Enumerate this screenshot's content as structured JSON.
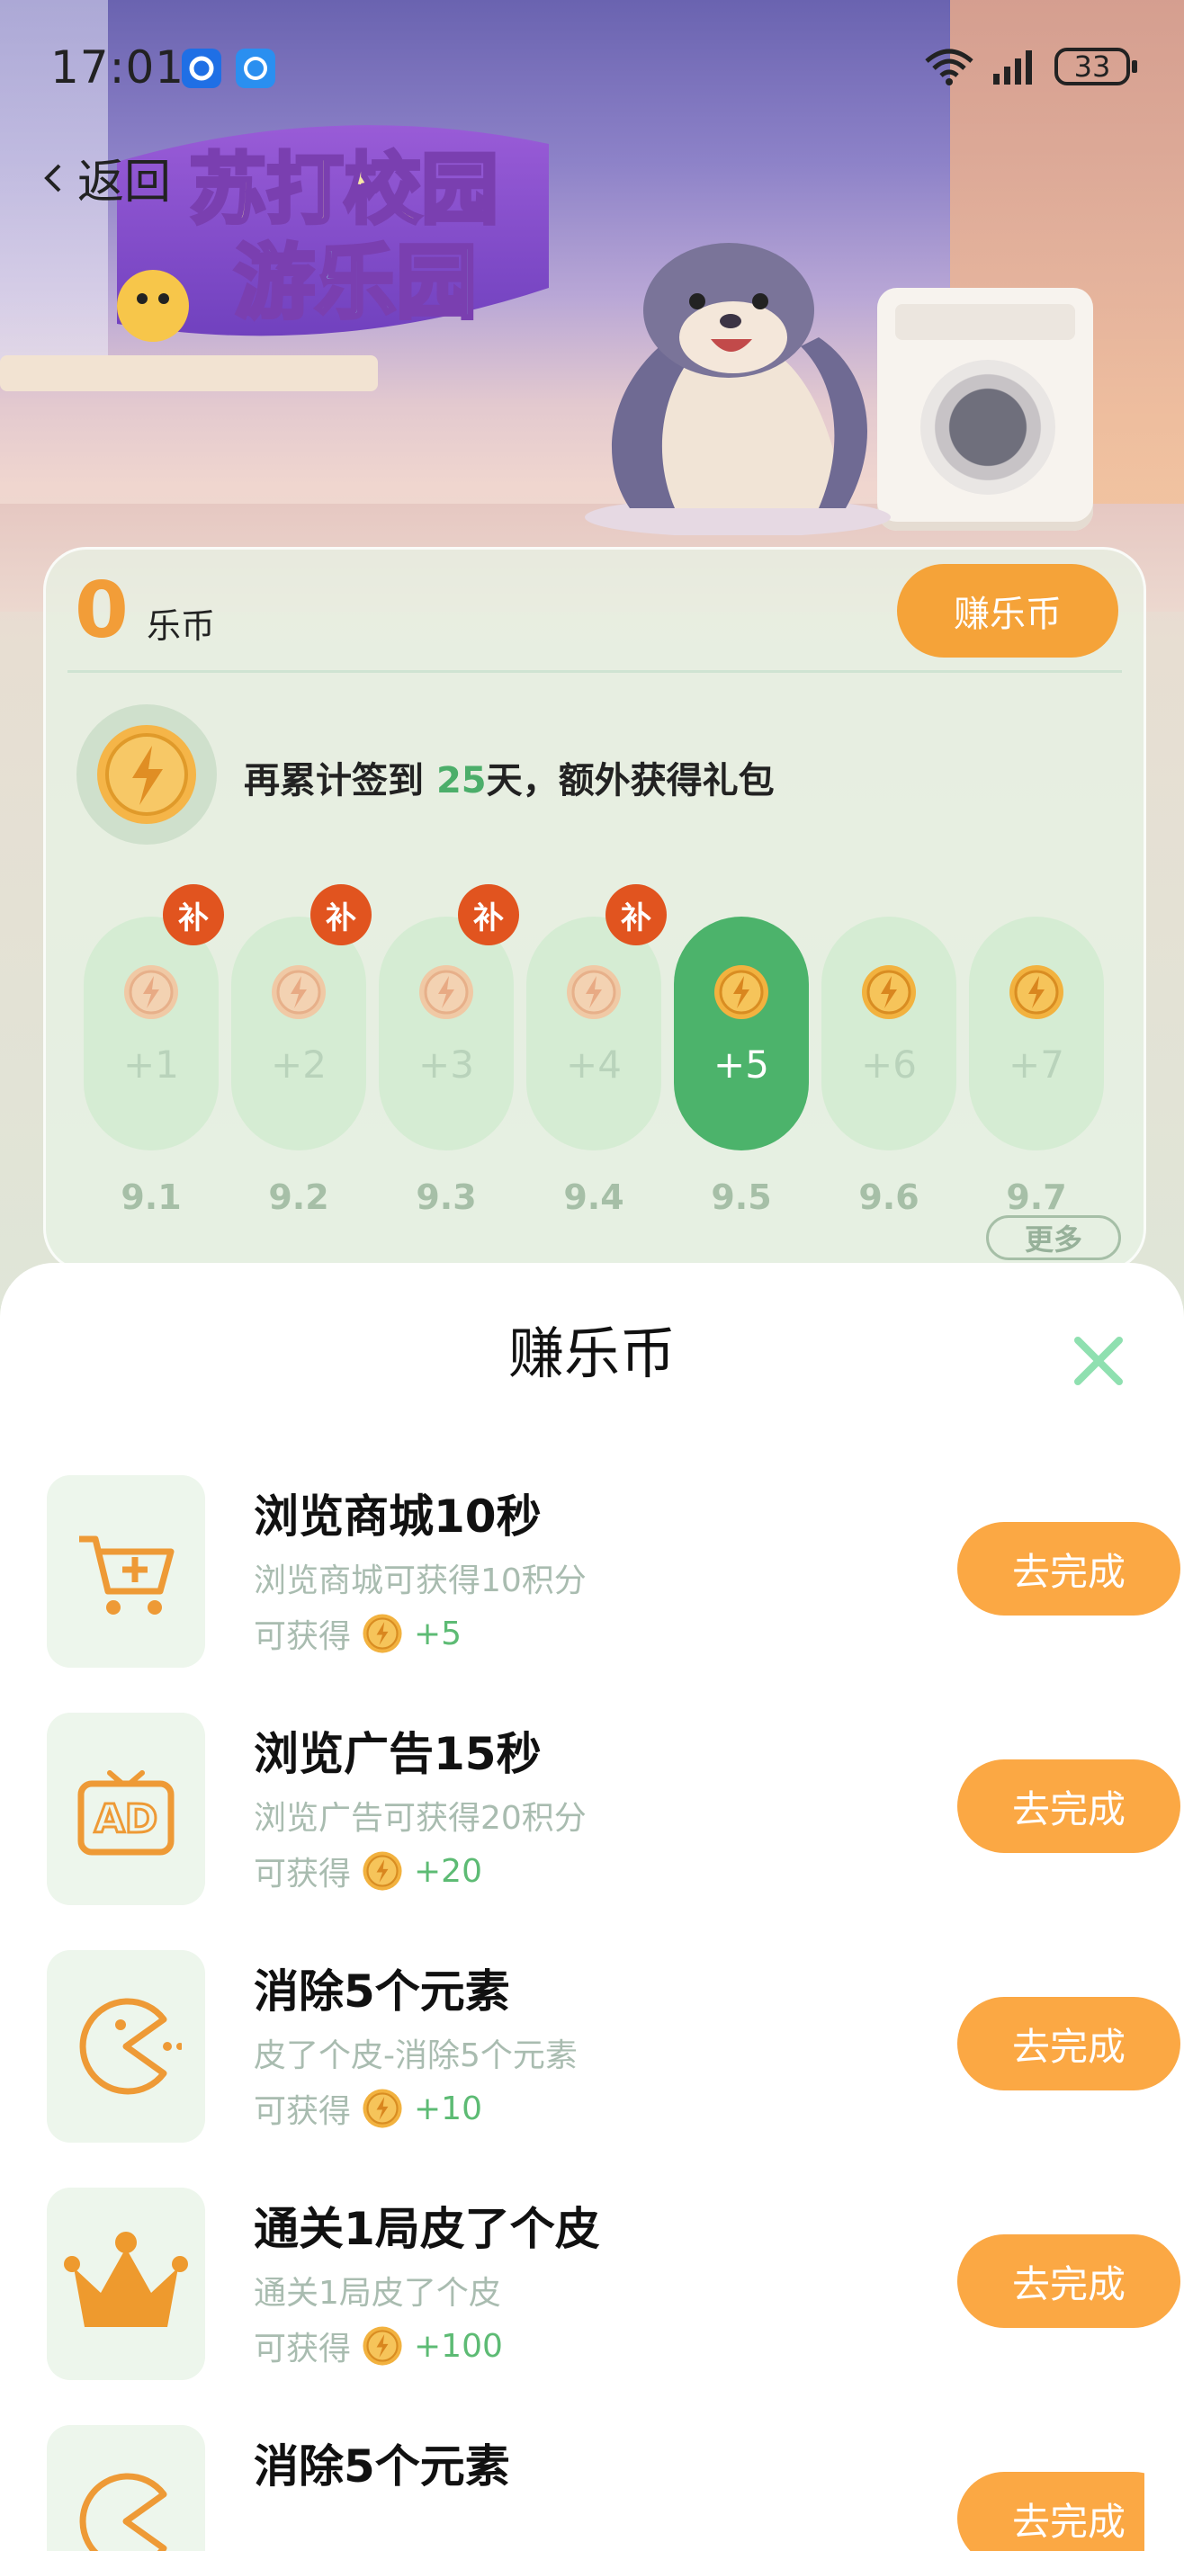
{
  "status_bar": {
    "time": "17:01",
    "battery": "33"
  },
  "nav": {
    "back_label": "返回"
  },
  "banner": {
    "logo_line1": "苏打校园",
    "logo_line2": "游乐园"
  },
  "points": {
    "count": "0",
    "unit": "乐币",
    "earn_button": "赚乐币",
    "checkin_prefix": "再累计签到 ",
    "checkin_days": "25",
    "checkin_suffix": "天，额外获得礼包",
    "days": [
      {
        "gain": "+1",
        "date": "9.1",
        "makeup": "补",
        "active": false
      },
      {
        "gain": "+2",
        "date": "9.2",
        "makeup": "补",
        "active": false
      },
      {
        "gain": "+3",
        "date": "9.3",
        "makeup": "补",
        "active": false
      },
      {
        "gain": "+4",
        "date": "9.4",
        "makeup": "补",
        "active": false
      },
      {
        "gain": "+5",
        "date": "9.5",
        "makeup": "",
        "active": true
      },
      {
        "gain": "+6",
        "date": "9.6",
        "makeup": "",
        "active": false
      },
      {
        "gain": "+7",
        "date": "9.7",
        "makeup": "",
        "active": false
      }
    ],
    "more_label": "更多"
  },
  "sheet": {
    "title": "赚乐币",
    "tasks": [
      {
        "icon": "cart-icon",
        "title": "浏览商城10秒",
        "desc": "浏览商城可获得10积分",
        "reward_label": "可获得",
        "reward": "+5",
        "button": "去完成"
      },
      {
        "icon": "ad-tv-icon",
        "title": "浏览广告15秒",
        "desc": "浏览广告可获得20积分",
        "reward_label": "可获得",
        "reward": "+20",
        "button": "去完成"
      },
      {
        "icon": "pacman-icon",
        "title": "消除5个元素",
        "desc": "皮了个皮-消除5个元素",
        "reward_label": "可获得",
        "reward": "+10",
        "button": "去完成"
      },
      {
        "icon": "crown-icon",
        "title": "通关1局皮了个皮",
        "desc": "通关1局皮了个皮",
        "reward_label": "可获得",
        "reward": "+100",
        "button": "去完成"
      },
      {
        "icon": "pacman-icon",
        "title": "消除5个元素",
        "desc": "",
        "reward_label": "",
        "reward": "",
        "button": "去完成"
      }
    ]
  },
  "colors": {
    "accent_orange": "#f5a339",
    "accent_green": "#4cb36b",
    "makeup_red": "#e1541f"
  }
}
